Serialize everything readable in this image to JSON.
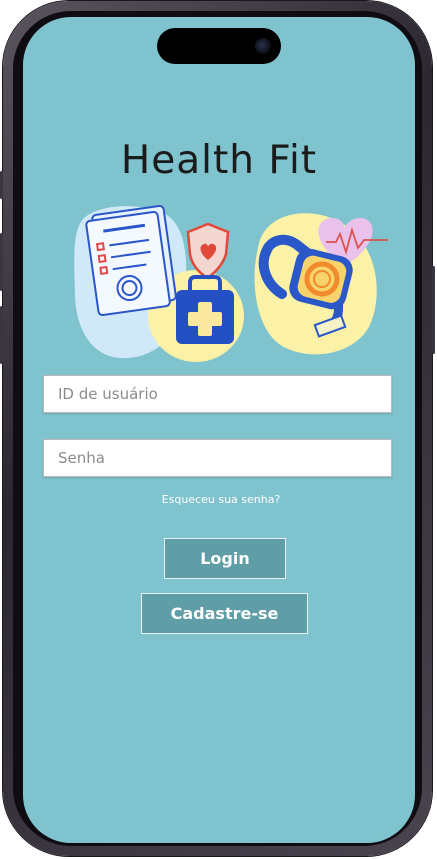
{
  "app": {
    "title": "Health Fit"
  },
  "login": {
    "user_id_placeholder": "ID de usuário",
    "password_placeholder": "Senha",
    "forgot_password_label": "Esqueceu sua senha?",
    "login_label": "Login",
    "signup_label": "Cadastre-se"
  },
  "illustration": {
    "icons": [
      "clipboard-checklist-icon",
      "shield-heart-icon",
      "first-aid-kit-icon",
      "smartwatch-icon",
      "heart-pulse-icon"
    ]
  },
  "colors": {
    "screen_background": "#7fc3ce",
    "button_background": "#5f9ea6",
    "title_text": "#1b1b1b"
  }
}
